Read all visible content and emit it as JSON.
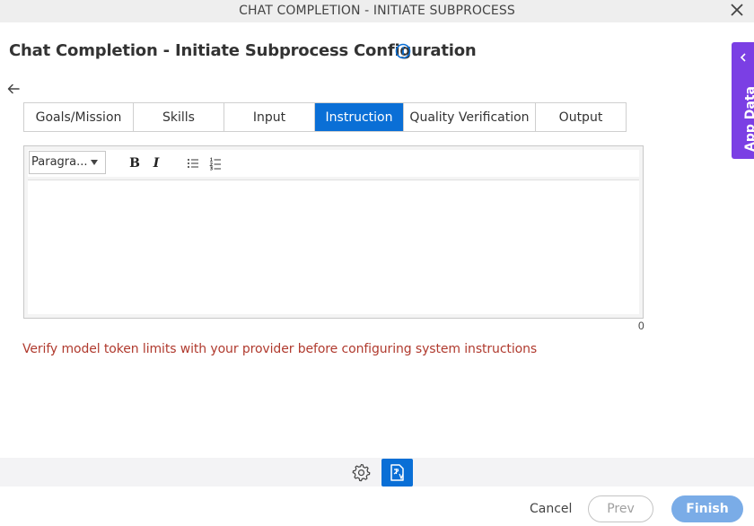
{
  "window": {
    "title": "CHAT COMPLETION - INITIATE SUBPROCESS",
    "close_icon": "close-icon"
  },
  "header": {
    "title": "Chat Completion - Initiate Subprocess Configuration",
    "info_icon": "info-icon"
  },
  "side_panel": {
    "label": "App Data",
    "chevron_icon": "chevron-left-icon",
    "color": "#7b3fe4"
  },
  "tabs": [
    {
      "label": "Goals/Mission",
      "active": false
    },
    {
      "label": "Skills",
      "active": false
    },
    {
      "label": "Input",
      "active": false
    },
    {
      "label": "Instruction",
      "active": true
    },
    {
      "label": "Quality Verification",
      "active": false
    },
    {
      "label": "Output",
      "active": false
    }
  ],
  "editor": {
    "format_selected": "Paragra...",
    "toolbar": {
      "bold": "B",
      "italic": "I",
      "bullet_list_icon": "bullet-list-icon",
      "numbered_list_icon": "numbered-list-icon"
    },
    "content": "",
    "char_count": "0"
  },
  "warning": {
    "text": "Verify model token limits with your provider before configuring system instructions",
    "color": "#b03a2e"
  },
  "bottom_bar": {
    "gear_icon": "gear-icon",
    "doc_icon": "document-translate-icon"
  },
  "footer": {
    "cancel": "Cancel",
    "prev": "Prev",
    "finish": "Finish"
  },
  "colors": {
    "accent": "#0a6fd6",
    "finish_button": "#7aace7"
  }
}
